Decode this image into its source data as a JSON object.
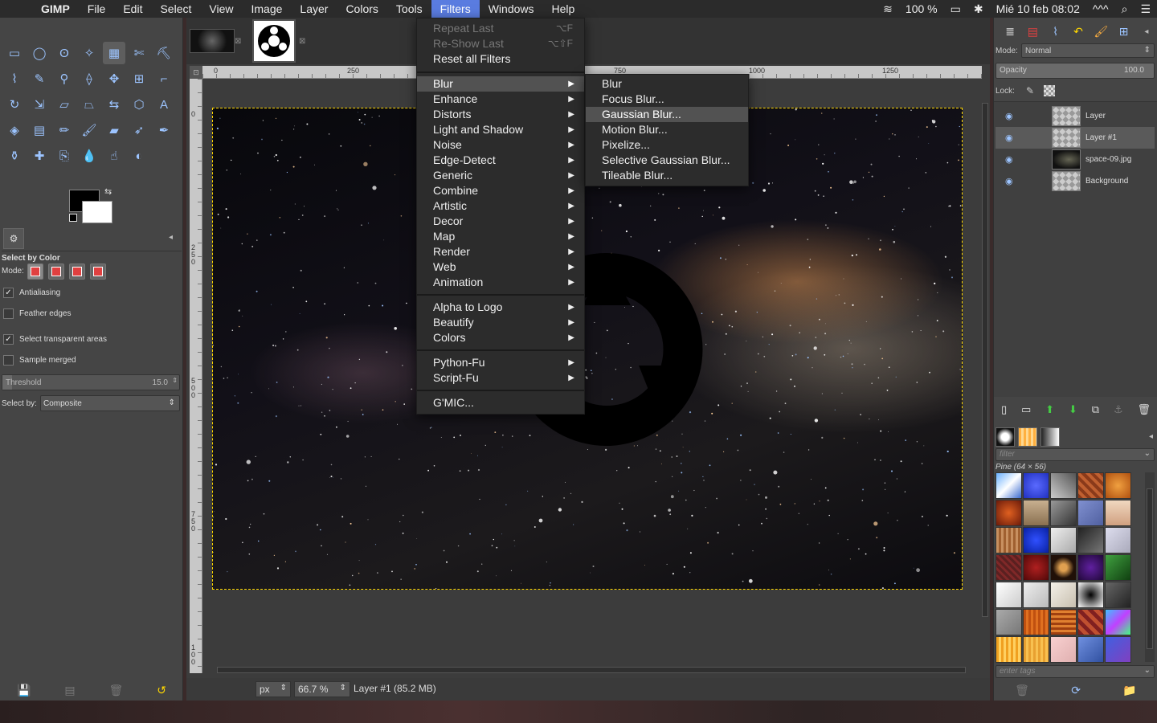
{
  "menubar": {
    "app_name": "GIMP",
    "items": [
      "File",
      "Edit",
      "Select",
      "View",
      "Image",
      "Layer",
      "Colors",
      "Tools",
      "Filters",
      "Windows",
      "Help"
    ],
    "active": "Filters",
    "battery": "100 %",
    "datetime": "Mié 10 feb  08:02",
    "extra": "^^^"
  },
  "filters_menu": {
    "repeat_last": "Repeat Last",
    "repeat_last_shortcut": "⌥F",
    "reshow_last": "Re-Show Last",
    "reshow_last_shortcut": "⌥⇧F",
    "reset_all": "Reset all Filters",
    "group1": [
      "Blur",
      "Enhance",
      "Distorts",
      "Light and Shadow",
      "Noise",
      "Edge-Detect",
      "Generic",
      "Combine",
      "Artistic",
      "Decor",
      "Map",
      "Render",
      "Web",
      "Animation"
    ],
    "group2": [
      "Alpha to Logo",
      "Beautify",
      "Colors"
    ],
    "group3": [
      "Python-Fu",
      "Script-Fu"
    ],
    "gmic": "G'MIC..."
  },
  "blur_menu": {
    "items": [
      "Blur",
      "Focus Blur...",
      "Gaussian Blur...",
      "Motion Blur...",
      "Pixelize...",
      "Selective Gaussian Blur...",
      "Tileable Blur..."
    ],
    "highlighted": "Gaussian Blur..."
  },
  "tool_options": {
    "title": "Select by Color",
    "mode_label": "Mode:",
    "antialiasing": "Antialiasing",
    "feather_edges": "Feather edges",
    "select_transparent": "Select transparent areas",
    "sample_merged": "Sample merged",
    "threshold_label": "Threshold",
    "threshold_value": "15.0",
    "select_by_label": "Select by:",
    "select_by_value": "Composite"
  },
  "rulers": {
    "h_ticks": [
      "0",
      "250",
      "750",
      "1000",
      "1250"
    ],
    "v_ticks": [
      "0",
      "250",
      "500",
      "750",
      "100"
    ]
  },
  "status": {
    "unit": "px",
    "zoom": "66.7 %",
    "info": "Layer #1 (85.2 MB)"
  },
  "layers_dock": {
    "mode_label": "Mode:",
    "mode_value": "Normal",
    "opacity_label": "Opacity",
    "opacity_value": "100.0",
    "lock_label": "Lock:",
    "layers": [
      "Layer",
      "Layer #1",
      "space-09.jpg",
      "Background"
    ],
    "selected_layer": "Layer #1"
  },
  "patterns_dock": {
    "filter_placeholder": "filter",
    "pattern_name": "Pine (64 × 56)",
    "tags_placeholder": "enter tags"
  },
  "colors": {
    "menu_highlight": "#5a7ce0",
    "selection_border": "#ffd800"
  }
}
